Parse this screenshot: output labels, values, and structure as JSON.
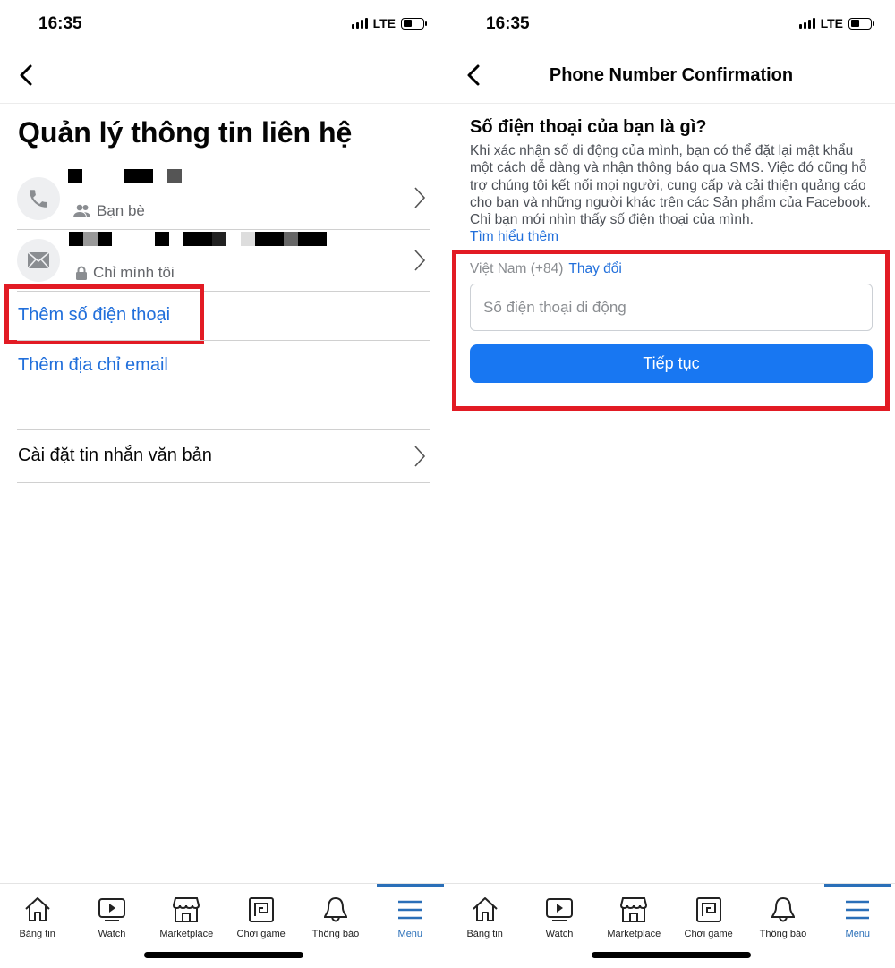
{
  "colors": {
    "accent": "#1877f2",
    "link": "#216fdb",
    "highlight": "#e21b24"
  },
  "status_bar": {
    "time": "16:35",
    "network": "LTE"
  },
  "left": {
    "title": "Quản lý thông tin liên hệ",
    "contacts": [
      {
        "icon": "phone-icon",
        "privacy_icon": "friends-icon",
        "privacy": "Bạn bè"
      },
      {
        "icon": "mail-icon",
        "privacy_icon": "lock-icon",
        "privacy": "Chỉ mình tôi"
      }
    ],
    "add_phone": "Thêm số điện thoại",
    "add_email": "Thêm địa chỉ email",
    "sms_settings": "Cài đặt tin nhắn văn bản"
  },
  "right": {
    "header_title": "Phone Number Confirmation",
    "question": "Số điện thoại của bạn là gì?",
    "description": "Khi xác nhận số di động của mình, bạn có thể đặt lại mật khẩu một cách dễ dàng và nhận thông báo qua SMS. Việc đó cũng hỗ trợ chúng tôi kết nối mọi người, cung cấp và cải thiện quảng cáo cho bạn và những người khác trên các Sản phẩm của Facebook. Chỉ bạn mới nhìn thấy số điện thoại của mình.",
    "learn_more": "Tìm hiểu thêm",
    "country": "Việt Nam (+84)",
    "change": "Thay đổi",
    "phone_placeholder": "Số điện thoại di động",
    "phone_value": "",
    "continue": "Tiếp tục"
  },
  "tabs": [
    {
      "label": "Bảng tin",
      "icon": "home-icon"
    },
    {
      "label": "Watch",
      "icon": "watch-icon"
    },
    {
      "label": "Marketplace",
      "icon": "marketplace-icon"
    },
    {
      "label": "Chơi game",
      "icon": "gaming-icon"
    },
    {
      "label": "Thông báo",
      "icon": "bell-icon"
    },
    {
      "label": "Menu",
      "icon": "menu-icon",
      "active": true
    }
  ]
}
